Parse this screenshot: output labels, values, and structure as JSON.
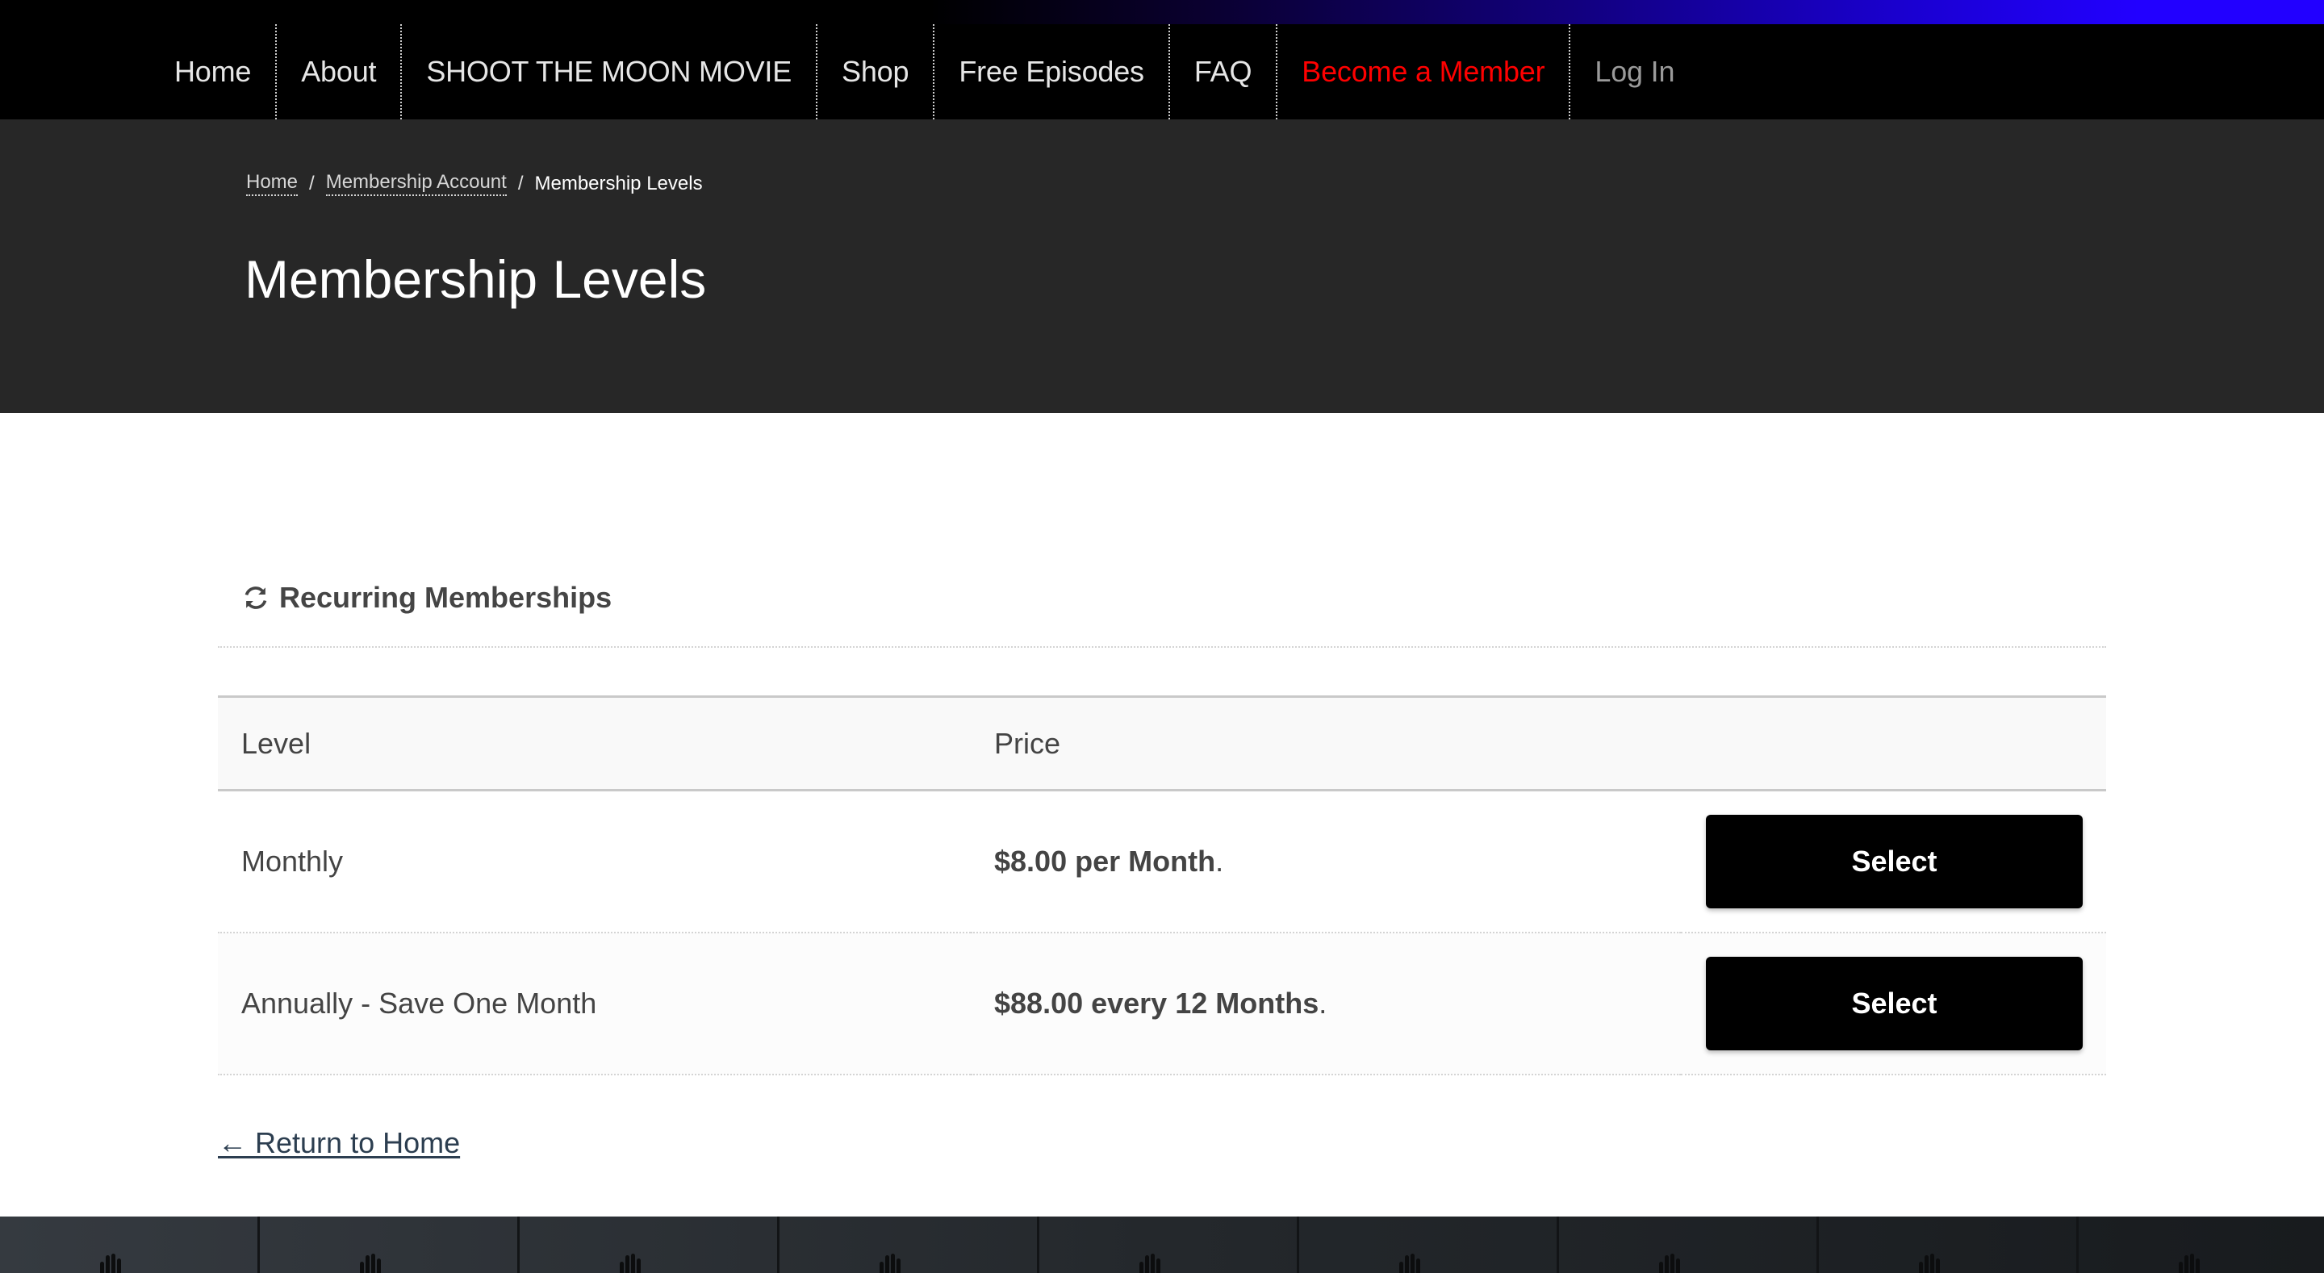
{
  "nav": {
    "items": [
      {
        "label": "Home",
        "style": "default"
      },
      {
        "label": "About",
        "style": "default"
      },
      {
        "label": "SHOOT THE MOON MOVIE",
        "style": "default"
      },
      {
        "label": "Shop",
        "style": "default"
      },
      {
        "label": "Free Episodes",
        "style": "default"
      },
      {
        "label": "FAQ",
        "style": "default"
      },
      {
        "label": "Become a Member",
        "style": "member"
      },
      {
        "label": "Log In",
        "style": "login"
      }
    ]
  },
  "breadcrumb": {
    "items": [
      "Home",
      "Membership Account"
    ],
    "separator": "/",
    "current": "Membership Levels"
  },
  "page": {
    "title": "Membership Levels"
  },
  "section": {
    "icon": "refresh-icon",
    "title": "Recurring Memberships"
  },
  "table": {
    "headers": [
      "Level",
      "Price",
      ""
    ],
    "rows": [
      {
        "level": "Monthly",
        "price": "$8.00 per Month",
        "price_suffix": ".",
        "button": "Select"
      },
      {
        "level": "Annually - Save One Month",
        "price": "$88.00 every 12 Months",
        "price_suffix": ".",
        "button": "Select"
      }
    ]
  },
  "return_link": {
    "arrow": "←",
    "label": "Return to Home"
  },
  "colors": {
    "member_link": "#ff0000",
    "login_link": "#9a9a9a",
    "hero_bg": "#272727",
    "button_bg": "#000000",
    "topbar_accent": "#2200ff"
  }
}
